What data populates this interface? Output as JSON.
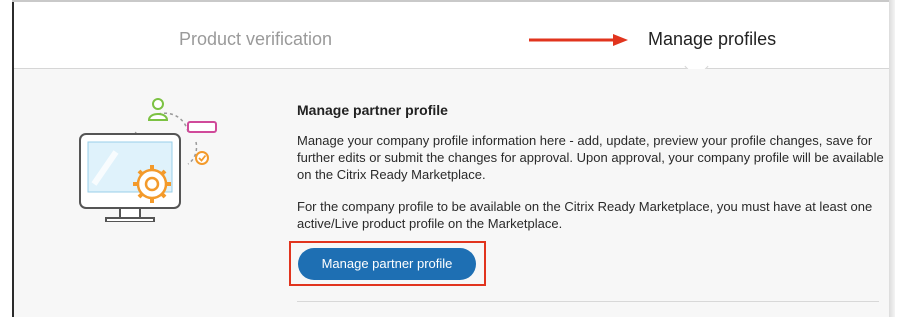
{
  "tabs": {
    "previous_label": "Product verification",
    "current_label": "Manage profiles"
  },
  "annotation": {
    "arrow_color": "#e1341e",
    "highlight_color": "#e1341e"
  },
  "section": {
    "heading": "Manage partner profile",
    "paragraph1": "Manage your company profile information here - add, update, preview your profile changes, save for further edits or submit the changes for approval. Upon approval, your company profile will be available on the Citrix Ready Marketplace.",
    "paragraph2": "For the company profile to be available on the Citrix Ready Marketplace, you must have at least one active/Live product profile on the Marketplace.",
    "button_label": "Manage partner profile"
  },
  "illustration": {
    "icon": "monitor-gear-icon"
  },
  "colors": {
    "button": "#1e6fb3",
    "accent_orange": "#f39a2b",
    "accent_green": "#7cc243",
    "accent_pink": "#d04a9a"
  }
}
